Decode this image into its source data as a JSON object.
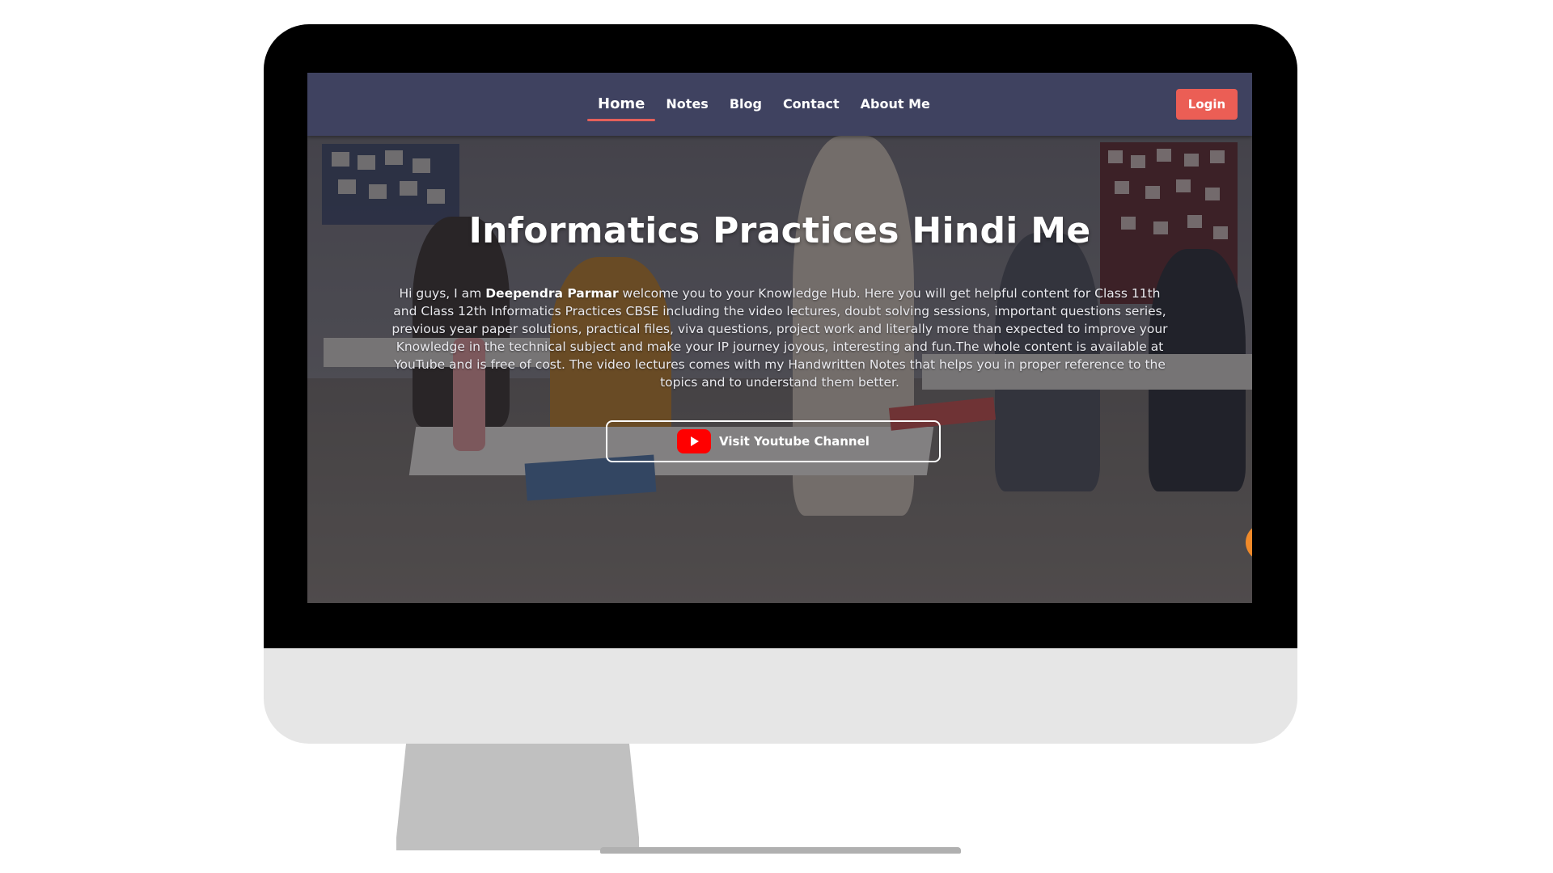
{
  "nav": {
    "links": [
      {
        "label": "Home",
        "active": true
      },
      {
        "label": "Notes",
        "active": false
      },
      {
        "label": "Blog",
        "active": false
      },
      {
        "label": "Contact",
        "active": false
      },
      {
        "label": "About Me",
        "active": false
      }
    ],
    "login_label": "Login",
    "bar_color": "#3f4260",
    "accent_color": "#eb5e55"
  },
  "hero": {
    "title": "Informatics Practices Hindi Me",
    "intro_prefix": "Hi guys, I am ",
    "author": "Deependra Parmar",
    "intro_body": " welcome you to your Knowledge Hub. Here you will get helpful content for Class 11th and Class 12th Informatics Practices CBSE including the video lectures, doubt solving sessions, important questions series, previous year paper solutions, practical files, viva questions, project work and literally more than expected to improve your Knowledge in the technical subject and make your IP journey joyous, interesting and fun.The whole content is available at YouTube and is free of cost. The video lectures comes with my Handwritten Notes that helps you in proper reference to the topics and to understand them better.",
    "cta_label": "Visit Youtube Channel",
    "cta_icon": "youtube-icon",
    "youtube_color": "#ff0000"
  }
}
